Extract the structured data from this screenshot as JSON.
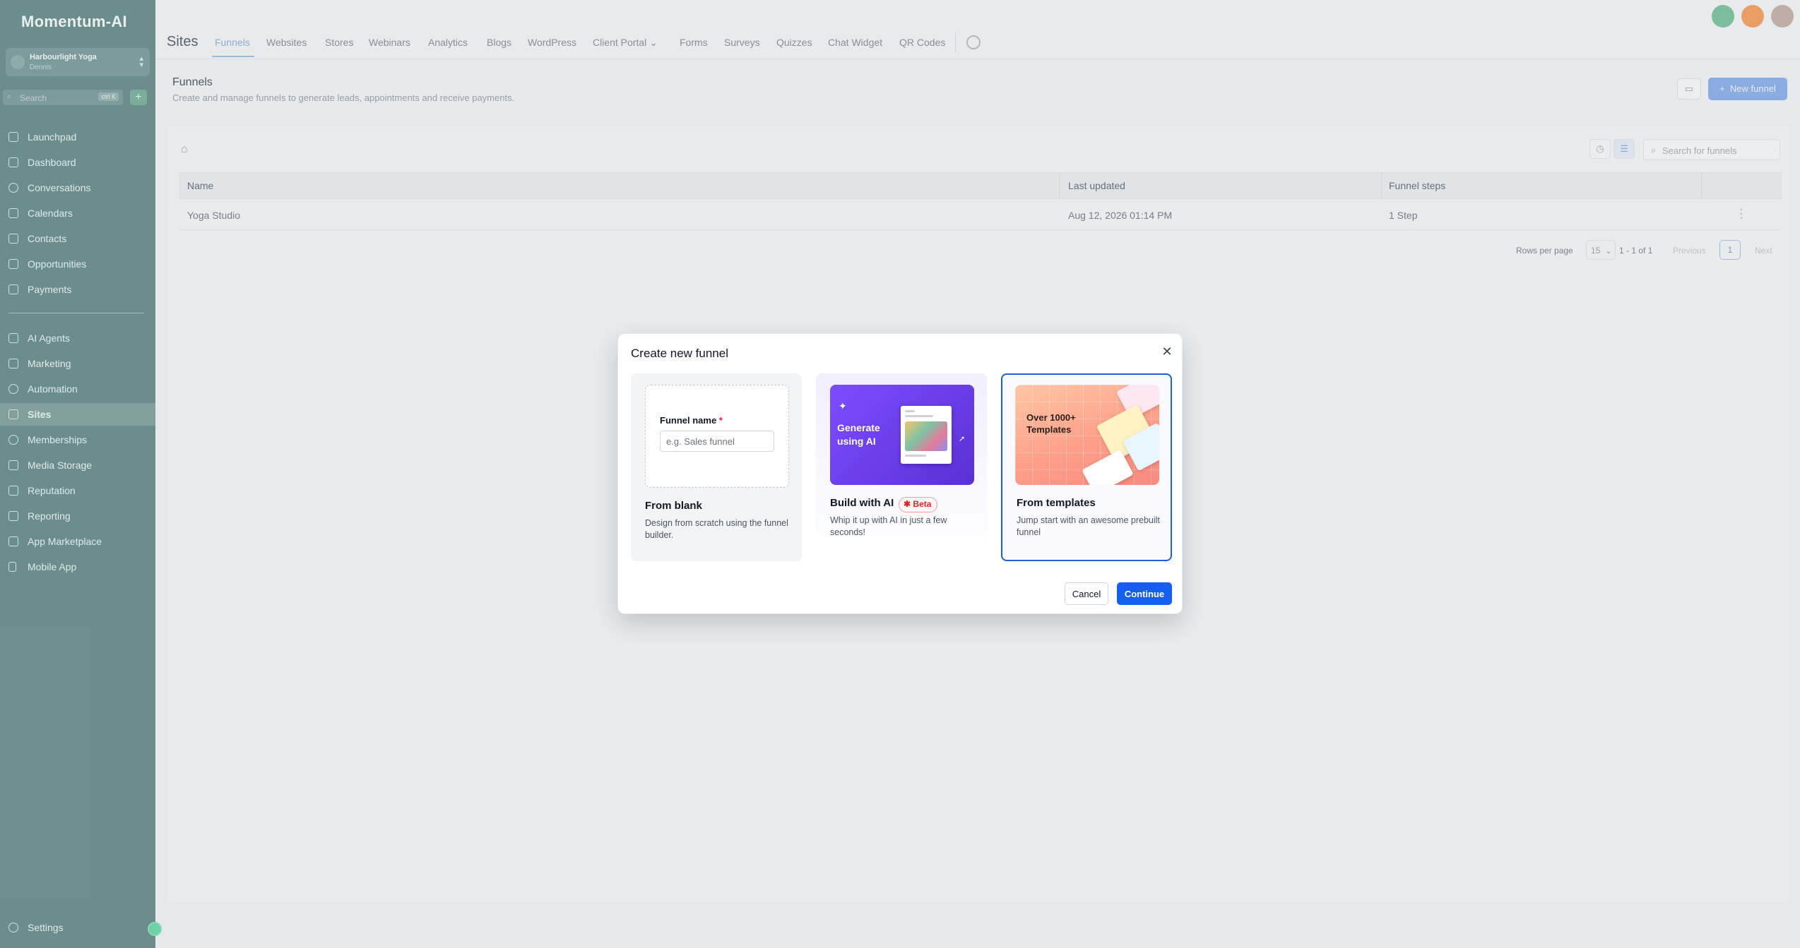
{
  "brand": {
    "logo": "Momentum-AI"
  },
  "account": {
    "name": "Harbourlight Yoga",
    "location": "Dennis"
  },
  "sidebar": {
    "search_placeholder": "Search",
    "search_shortcut": "ctrl K",
    "items": [
      {
        "label": "Launchpad"
      },
      {
        "label": "Dashboard"
      },
      {
        "label": "Conversations"
      },
      {
        "label": "Calendars"
      },
      {
        "label": "Contacts"
      },
      {
        "label": "Opportunities"
      },
      {
        "label": "Payments"
      },
      {
        "label": "AI Agents"
      },
      {
        "label": "Marketing"
      },
      {
        "label": "Automation"
      },
      {
        "label": "Sites"
      },
      {
        "label": "Memberships"
      },
      {
        "label": "Media Storage"
      },
      {
        "label": "Reputation"
      },
      {
        "label": "Reporting"
      },
      {
        "label": "App Marketplace"
      },
      {
        "label": "Mobile App"
      }
    ],
    "settings_label": "Settings"
  },
  "header": {
    "section_title": "Sites",
    "tabs": [
      {
        "label": "Funnels"
      },
      {
        "label": "Websites"
      },
      {
        "label": "Stores"
      },
      {
        "label": "Webinars"
      },
      {
        "label": "Analytics"
      },
      {
        "label": "Blogs"
      },
      {
        "label": "WordPress"
      },
      {
        "label": "Client Portal"
      },
      {
        "label": "Forms"
      },
      {
        "label": "Surveys"
      },
      {
        "label": "Quizzes"
      },
      {
        "label": "Chat Widget"
      },
      {
        "label": "QR Codes"
      }
    ]
  },
  "page": {
    "title": "Funnels",
    "subtitle": "Create and manage funnels to generate leads, appointments and receive payments.",
    "new_button": "New funnel",
    "search_placeholder": "Search for funnels"
  },
  "table": {
    "columns": [
      "Name",
      "Last updated",
      "Funnel steps"
    ],
    "rows": [
      {
        "name": "Yoga Studio",
        "updated": "Aug 12, 2026 01:14 PM",
        "steps": "1 Step"
      }
    ],
    "pagination": {
      "rows_per_page_label": "Rows per page",
      "rows_per_page": "15",
      "range": "1 - 1 of 1",
      "previous": "Previous",
      "page": "1",
      "next": "Next"
    }
  },
  "modal": {
    "title": "Create new funnel",
    "blank": {
      "field_label": "Funnel name",
      "required_mark": "*",
      "placeholder": "e.g. Sales funnel",
      "title": "From blank",
      "description": "Design from scratch using the funnel builder."
    },
    "ai": {
      "art_text": "Generate using AI",
      "title": "Build with AI",
      "badge": "Beta",
      "description": "Whip it up with AI in just a few seconds!"
    },
    "templates": {
      "art_text": "Over 1000+ Templates",
      "title": "From templates",
      "description": "Jump start with an awesome prebuilt funnel"
    },
    "cancel": "Cancel",
    "continue": "Continue"
  },
  "colors": {
    "primary": "#155eef",
    "sidebar": "#6e9190",
    "beta": "#dc2626"
  }
}
